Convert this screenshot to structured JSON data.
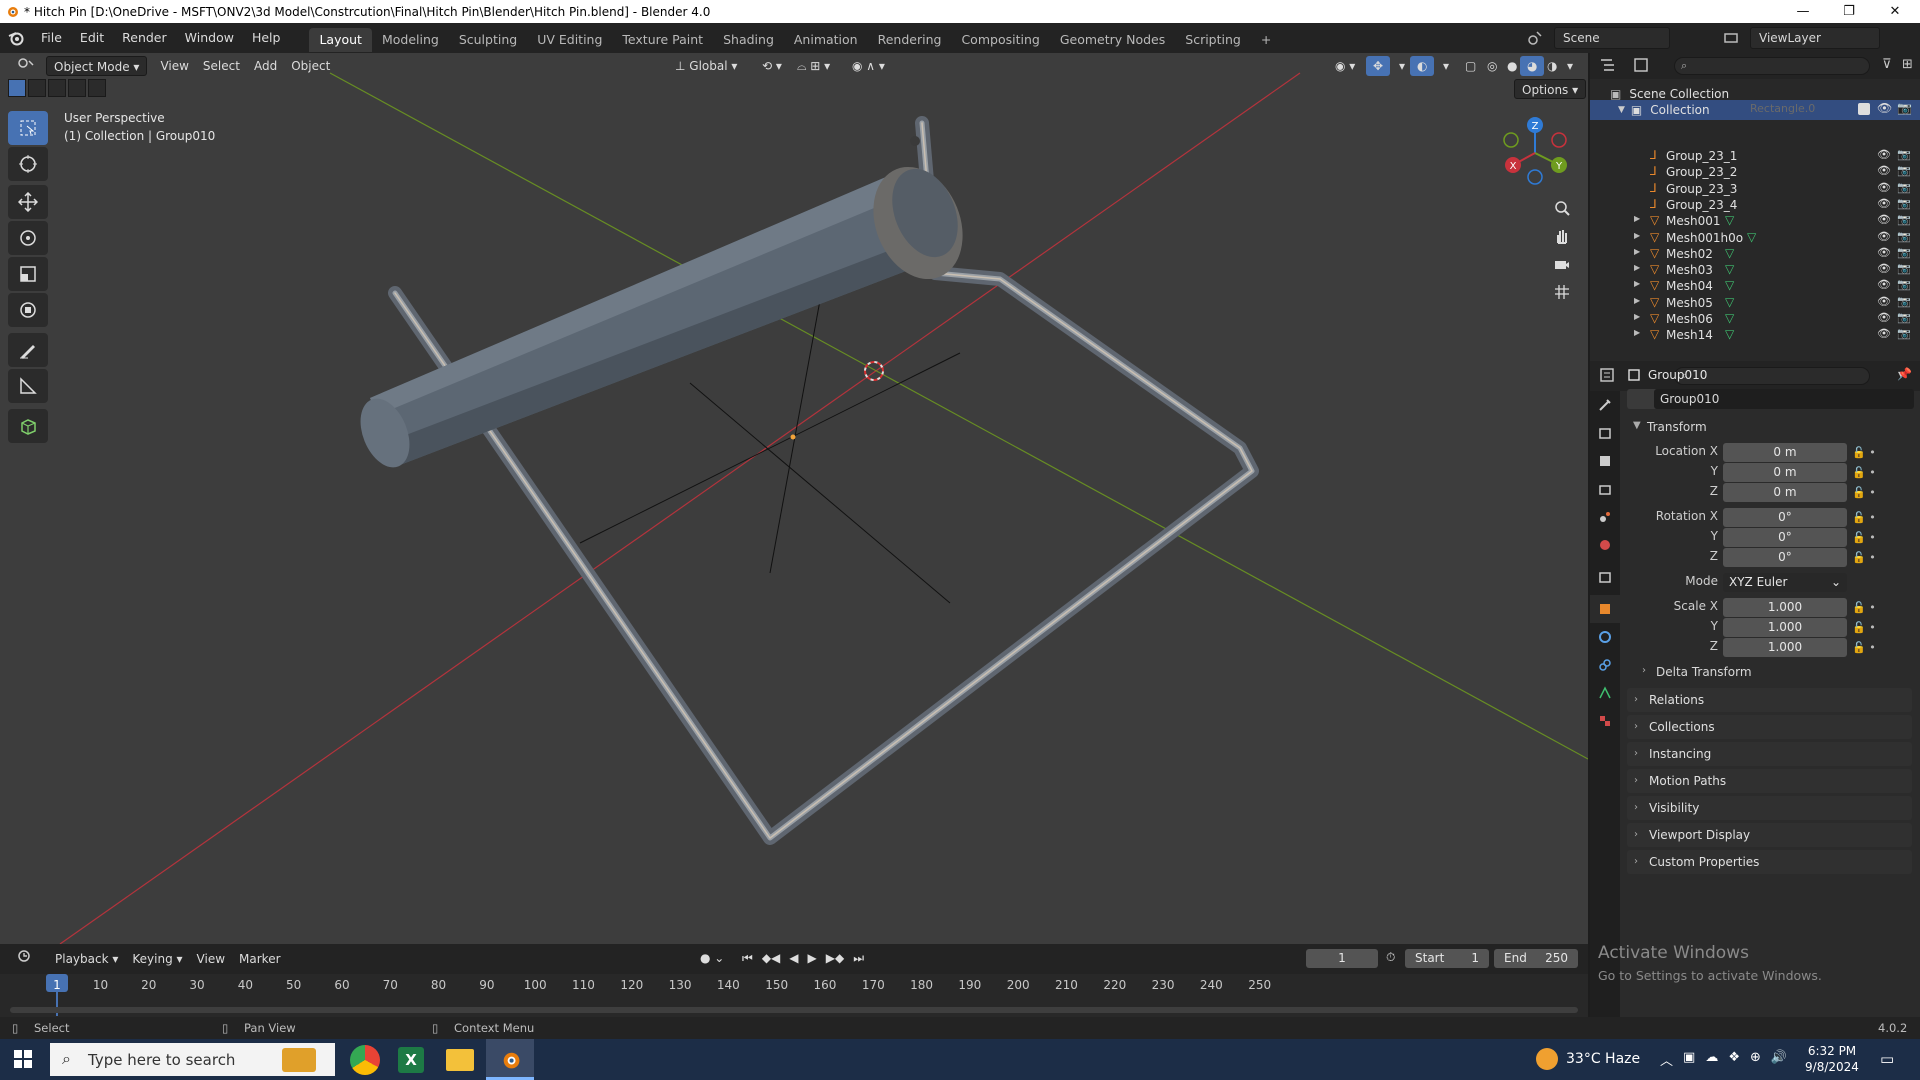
{
  "title_bar": {
    "title": "* Hitch Pin [D:\\OneDrive - MSFT\\ONV2\\3d Model\\Constrcution\\Final\\Hitch Pin\\Blender\\Hitch Pin.blend] - Blender 4.0",
    "minimize": "—",
    "maximize": "❐",
    "close": "✕"
  },
  "menu": {
    "items": [
      "File",
      "Edit",
      "Render",
      "Window",
      "Help"
    ],
    "workspaces": [
      "Layout",
      "Modeling",
      "Sculpting",
      "UV Editing",
      "Texture Paint",
      "Shading",
      "Animation",
      "Rendering",
      "Compositing",
      "Geometry Nodes",
      "Scripting"
    ],
    "active_workspace": "Layout",
    "add_tab": "+",
    "scene_label": "Scene",
    "viewlayer_label": "ViewLayer"
  },
  "viewport": {
    "mode": "Object Mode",
    "menus": [
      "View",
      "Select",
      "Add",
      "Object"
    ],
    "transform_orientation": "Global",
    "options_label": "Options",
    "overlay_line1": "User Perspective",
    "overlay_line2": "(1) Collection | Group010",
    "gizmo_axes": {
      "x": "X",
      "y": "Y",
      "z": "Z"
    },
    "colors": {
      "x_axis": "#c8323c",
      "y_axis": "#6f9c1f",
      "z_axis": "#2f7bd6",
      "background": "#3d3d3d",
      "active_tool": "#4772b3"
    }
  },
  "outliner": {
    "scene_collection": "Scene Collection",
    "collection": "Collection",
    "ghost_label": "Rectangle.0",
    "items": [
      "Group_23_1",
      "Group_23_2",
      "Group_23_3",
      "Group_23_4",
      "Mesh001",
      "Mesh001h0o",
      "Mesh02",
      "Mesh03",
      "Mesh04",
      "Mesh05",
      "Mesh06",
      "Mesh14"
    ]
  },
  "properties": {
    "object_name": "Group010",
    "object_field": "Group010",
    "transform_header": "Transform",
    "location_label": "Location X",
    "rotation_label": "Rotation X",
    "scale_label": "Scale X",
    "axis_y": "Y",
    "axis_z": "Z",
    "location": [
      "0 m",
      "0 m",
      "0 m"
    ],
    "rotation": [
      "0°",
      "0°",
      "0°"
    ],
    "mode_label": "Mode",
    "mode_value": "XYZ Euler",
    "scale": [
      "1.000",
      "1.000",
      "1.000"
    ],
    "delta_transform": "Delta Transform",
    "panels": [
      "Relations",
      "Collections",
      "Instancing",
      "Motion Paths",
      "Visibility",
      "Viewport Display",
      "Custom Properties"
    ],
    "watermark_1": "Activate Windows",
    "watermark_2": "Go to Settings to activate Windows."
  },
  "timeline": {
    "menus": [
      "Playback",
      "Keying",
      "View",
      "Marker"
    ],
    "current_frame": "1",
    "start_label": "Start",
    "start_value": "1",
    "end_label": "End",
    "end_value": "250",
    "ticks": [
      "1",
      "10",
      "20",
      "30",
      "40",
      "50",
      "60",
      "70",
      "80",
      "90",
      "100",
      "110",
      "120",
      "130",
      "140",
      "150",
      "160",
      "170",
      "180",
      "190",
      "200",
      "210",
      "220",
      "230",
      "240",
      "250"
    ]
  },
  "status_bar": {
    "select": "Select",
    "pan_view": "Pan View",
    "context_menu": "Context Menu",
    "version": "4.0.2"
  },
  "taskbar": {
    "search_placeholder": "Type here to search",
    "weather": "33°C  Haze",
    "time": "6:32 PM",
    "date": "9/8/2024"
  }
}
